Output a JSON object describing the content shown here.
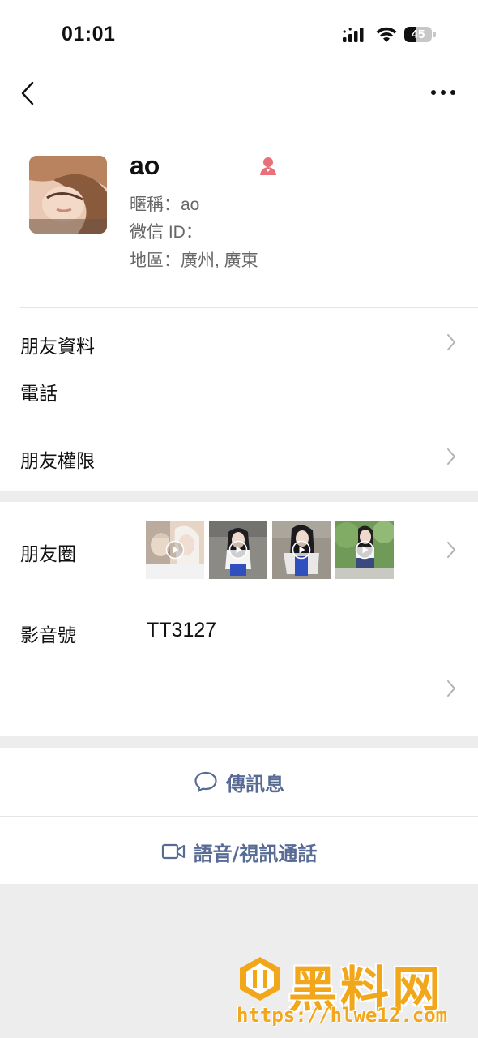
{
  "status_bar": {
    "time": "01:01",
    "battery": "45",
    "battery_level": 0.45
  },
  "nav": {
    "back_icon": "chevron-left-icon",
    "more_icon": "more-dots-icon"
  },
  "profile": {
    "name": "ao",
    "gender_icon": "female-icon",
    "nickname": "暱稱：ao",
    "wechat_id": "微信 ID：",
    "region": "地區：廣州, 廣東"
  },
  "rows": {
    "friend_info": "朋友資料",
    "phone": "電話",
    "permissions": "朋友權限"
  },
  "moments": {
    "label": "朋友圈",
    "thumbnails": [
      {
        "kind": "video",
        "colors": [
          "#e6d4c4",
          "#3a2e2a",
          "#f4f0ec"
        ]
      },
      {
        "kind": "video",
        "colors": [
          "#8c8a84",
          "#1d1d22",
          "#2f4fbf"
        ]
      },
      {
        "kind": "video",
        "colors": [
          "#9a948a",
          "#1a1a1f",
          "#e9e7e8"
        ]
      },
      {
        "kind": "video",
        "colors": [
          "#6f9a58",
          "#20201f",
          "#3a4a80"
        ]
      }
    ]
  },
  "channels": {
    "label": "影音號",
    "value": "TT3127"
  },
  "actions": {
    "message": "傳訊息",
    "call": "語音/視訊通話"
  },
  "watermark": {
    "title": "黑料网",
    "url": "https://hlwe12.com"
  },
  "colors": {
    "link": "#576b95",
    "accent_female": "#e8707a",
    "watermark": "#f2a71a",
    "background": "#ededed"
  }
}
